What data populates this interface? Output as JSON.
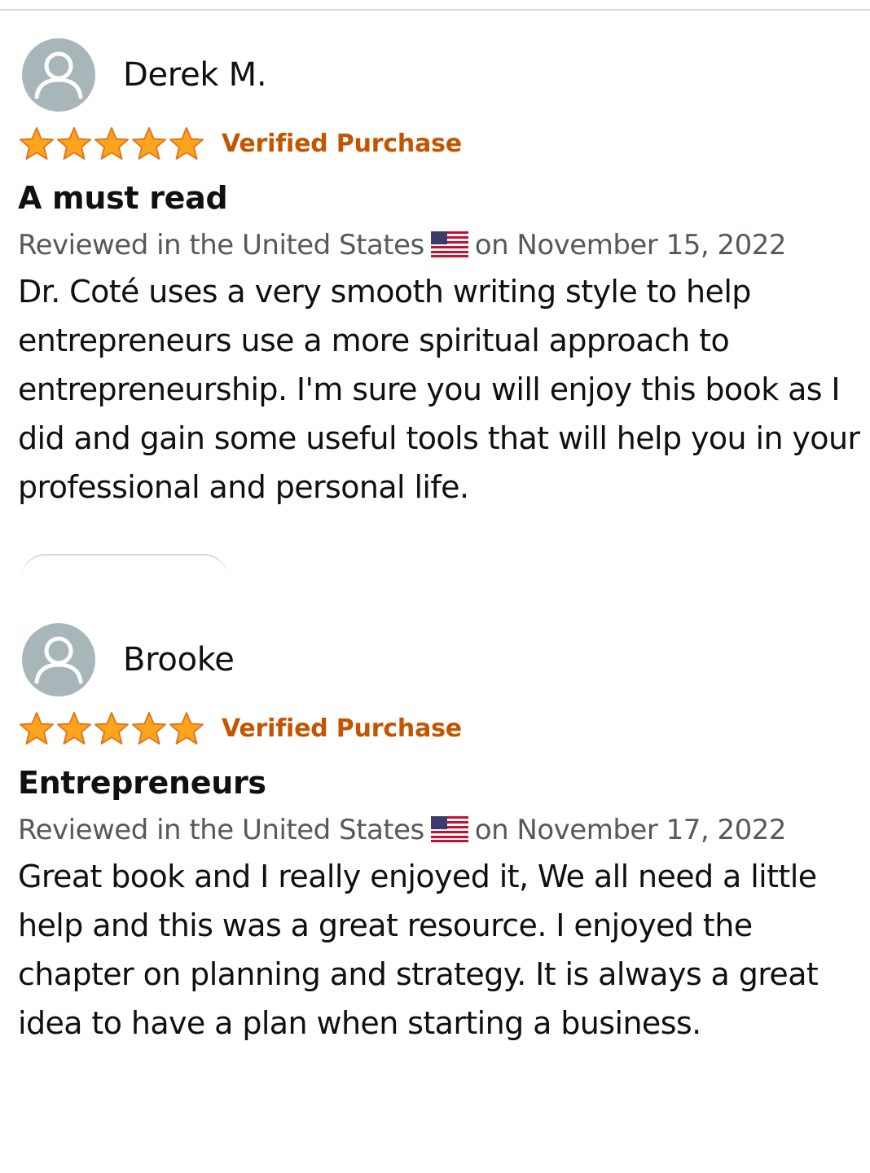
{
  "reviews": [
    {
      "author": "Derek M.",
      "rating": 5,
      "rating_max": 5,
      "badge": "Verified Purchase",
      "title": "A must read",
      "meta_prefix": "Reviewed in the United States",
      "meta_date": "on November 15, 2022",
      "flag_icon": "us-flag-icon",
      "body": "Dr. Coté uses a very smooth writing style to help entrepreneurs use a more spiritual approach to entrepreneurship. I'm sure you will enjoy this book as I did and gain some useful tools that will help you in your professional and personal life."
    },
    {
      "author": "Brooke",
      "rating": 5,
      "rating_max": 5,
      "badge": "Verified Purchase",
      "title": "Entrepreneurs",
      "meta_prefix": "Reviewed in the United States",
      "meta_date": "on November 17, 2022",
      "flag_icon": "us-flag-icon",
      "body": "Great book and I really enjoyed it, We all need a little help and this was a great resource. I enjoyed the chapter on planning and strategy. It is always a great idea to have a plan when starting a business."
    }
  ],
  "colors": {
    "star": "#ffa41c",
    "star_outline": "#de7921",
    "verified": "#c45500",
    "meta": "#565959",
    "text": "#0f1111",
    "avatar": "#a9b6b9"
  }
}
